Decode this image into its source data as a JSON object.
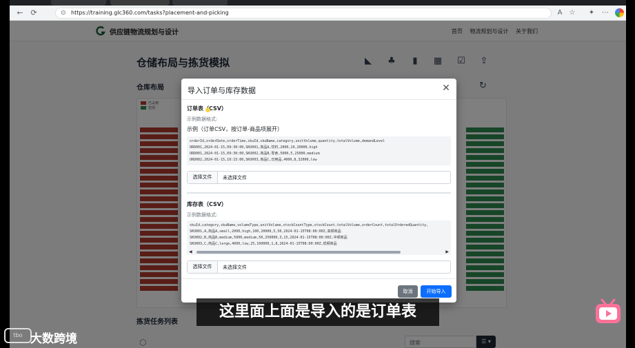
{
  "browser": {
    "tabs": [
      "",
      "",
      ""
    ],
    "url": "https://training.glc360.com/tasks?placement-and-picking"
  },
  "app": {
    "brand": "供应链物流规划与设计",
    "nav": [
      "首页",
      "物流规划与设计",
      "关于我们"
    ],
    "page_title": "仓储布局与拣货模拟",
    "warehouse_title": "仓库布局",
    "legend": [
      "已占用",
      "空闲"
    ],
    "slot_label": "",
    "tasks_title": "拣货任务列表",
    "search_placeholder": "搜索"
  },
  "modal": {
    "title": "导入订单与库存数据",
    "orders": {
      "title": "订单表（CSV）",
      "hint": "示例数据格式:",
      "example": "示例（订单CSV，按订单-商品项展开）",
      "code": [
        "orderId,orderDate,orderTime,skuId,skuName,category,unitVolume,quantity,totalVolume,demandLevel",
        "ORD001,2024-01-15,09:30:00,SKU001,商品A,饮料,2000,10,20000,high",
        "ORD001,2024-01-15,09:30:00,SKU002,商品B,零食,5000,5,25000,medium",
        "ORD002,2024-01-15,10:15:00,SKU003,商品C,日用品,4000,8,32000,low"
      ],
      "file_button": "选择文件",
      "file_name": "未选择文件"
    },
    "inventory": {
      "title": "库存表（CSV）",
      "hint": "示例数据格式:",
      "code": [
        "skuId,category,skuName,volumeType,unitVolume,stockCountType,stockCount,totalVolume,orderCount,totalOrderedQuantity,",
        "SKU001,A,商品A,small,2000,high,100,20000,5,50,2024-01-15T08:00:00Z,高频商品",
        "SKU002,B,商品B,medium,5000,medium,50,250000,3,15,2024-01-15T08:00:00Z,中频商品",
        "SKU003,C,商品C,large,4000,low,25,100000,1,8,2024-01-15T08:00:00Z,低频商品"
      ],
      "file_button": "选择文件",
      "file_name": "未选择文件"
    },
    "cancel_label": "取消",
    "import_label": "开始导入"
  },
  "video": {
    "subtitle": "这里面上面是导入的是订单表",
    "watermark_logo": "tbo",
    "watermark_text": "大数跨境"
  },
  "colors": {
    "primary": "#0d6efd",
    "secondary": "#6c757d",
    "occupied": "#b23b2e",
    "free": "#2f8a4f",
    "bilibili_pink": "#fb7299"
  }
}
